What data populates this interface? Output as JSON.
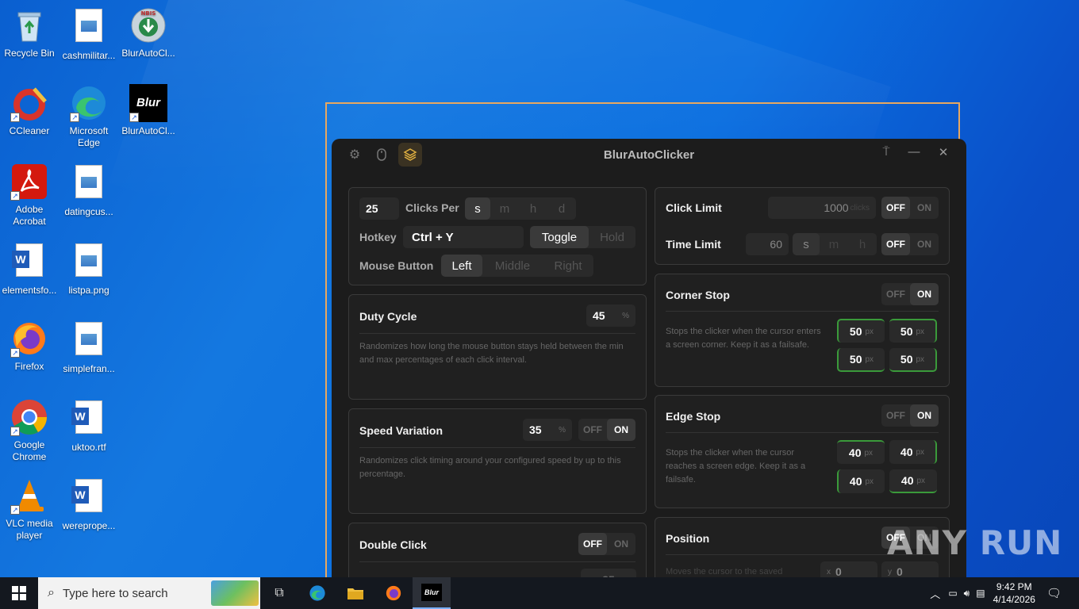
{
  "desktop": {
    "icons": [
      {
        "label": "Recycle Bin"
      },
      {
        "label": "cashmilitar..."
      },
      {
        "label": "BlurAutoCl..."
      },
      {
        "label": "CCleaner"
      },
      {
        "label": "Microsoft Edge"
      },
      {
        "label": "BlurAutoCl..."
      },
      {
        "label": "Adobe Acrobat"
      },
      {
        "label": "datingcus..."
      },
      {
        "label": "elementsfo..."
      },
      {
        "label": "listpa.png"
      },
      {
        "label": "Firefox"
      },
      {
        "label": "simplefran..."
      },
      {
        "label": "Google Chrome"
      },
      {
        "label": "uktoo.rtf"
      },
      {
        "label": "VLC media player"
      },
      {
        "label": "wereprope..."
      }
    ],
    "blur_logo": "Blur",
    "nbis_logo": "NBIS"
  },
  "app": {
    "title": "BlurAutoClicker",
    "accent": "#e0b040",
    "click_rate": {
      "value": "25",
      "clicks_per_label": "Clicks Per",
      "units": [
        "s",
        "m",
        "h",
        "d"
      ],
      "selected_unit": "s",
      "hotkey_label": "Hotkey",
      "hotkey_value": "Ctrl + Y",
      "modes": [
        "Toggle",
        "Hold"
      ],
      "selected_mode": "Toggle",
      "mouse_button_label": "Mouse Button",
      "buttons": [
        "Left",
        "Middle",
        "Right"
      ],
      "selected_button": "Left"
    },
    "duty_cycle": {
      "title": "Duty Cycle",
      "value": "45",
      "unit": "%",
      "description": "Randomizes how long the mouse button stays held between the min and max percentages of each click interval."
    },
    "speed_variation": {
      "title": "Speed Variation",
      "value": "35",
      "unit": "%",
      "off": "OFF",
      "on": "ON",
      "state": "ON",
      "description": "Randomizes click timing around your configured speed by up to this percentage."
    },
    "double_click": {
      "title": "Double Click",
      "off": "OFF",
      "on": "ON",
      "state": "OFF",
      "partial_value": "35"
    },
    "click_limit": {
      "title": "Click Limit",
      "value": "1000",
      "unit": "clicks",
      "off": "OFF",
      "on": "ON",
      "state": "OFF"
    },
    "time_limit": {
      "title": "Time Limit",
      "value": "60",
      "units": [
        "s",
        "m",
        "h"
      ],
      "off": "OFF",
      "on": "ON",
      "state": "OFF"
    },
    "corner_stop": {
      "title": "Corner Stop",
      "off": "OFF",
      "on": "ON",
      "state": "ON",
      "description": "Stops the clicker when the cursor enters a screen corner. Keep it as a failsafe.",
      "values": [
        "50",
        "50",
        "50",
        "50"
      ],
      "unit": "px"
    },
    "edge_stop": {
      "title": "Edge Stop",
      "off": "OFF",
      "on": "ON",
      "state": "ON",
      "description": "Stops the clicker when the cursor reaches a screen edge. Keep it as a failsafe.",
      "values": [
        "40",
        "40",
        "40",
        "40"
      ],
      "unit": "px"
    },
    "position": {
      "title": "Position",
      "off": "OFF",
      "on": "ON",
      "state": "OFF",
      "description_partial": "Moves the cursor to the saved",
      "x_label": "x",
      "x_value": "0",
      "y_label": "y",
      "y_value": "0"
    }
  },
  "watermark": "ANY RUN",
  "taskbar": {
    "search_placeholder": "Type here to search",
    "active_app_label": "Blur",
    "time": "9:42 PM",
    "date": "4/14/2026"
  }
}
